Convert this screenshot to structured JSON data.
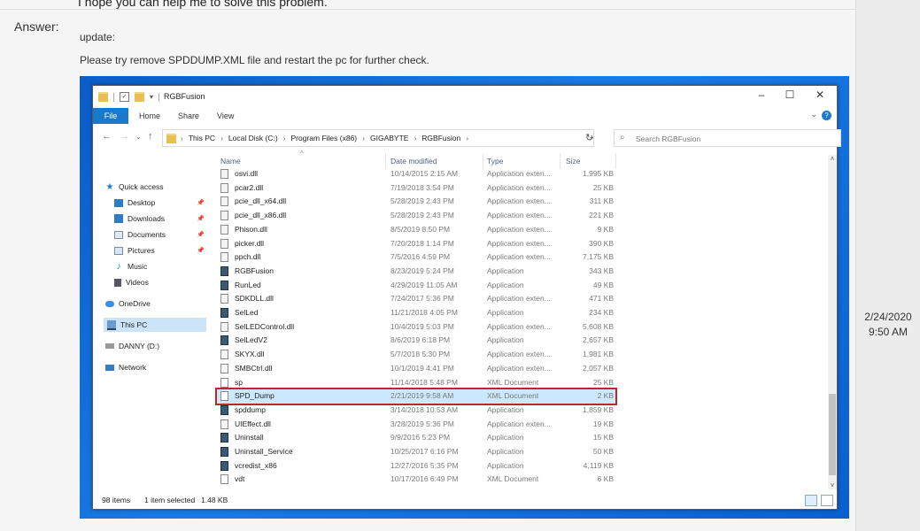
{
  "post": {
    "previous_text": "I hope you can help me to solve this problem.",
    "answer_label": "Answer:",
    "line1": "update:",
    "line2": "Please try  remove SPDDUMP.XML file and restart the pc for further check.",
    "timestamp_date": "2/24/2020",
    "timestamp_time": "9:50 AM"
  },
  "explorer": {
    "window_title": "RGBFusion",
    "tabs": [
      "File",
      "Home",
      "Share",
      "View"
    ],
    "breadcrumbs": [
      "This PC",
      "Local Disk (C:)",
      "Program Files (x86)",
      "GIGABYTE",
      "RGBFusion"
    ],
    "search_placeholder": "Search RGBFusion",
    "nav": [
      {
        "label": "Quick access",
        "icon": "star-icon"
      },
      {
        "label": "Desktop",
        "icon": "desktop-icon",
        "pinned": true
      },
      {
        "label": "Downloads",
        "icon": "downloads-icon",
        "pinned": true
      },
      {
        "label": "Documents",
        "icon": "documents-icon",
        "pinned": true
      },
      {
        "label": "Pictures",
        "icon": "pictures-icon",
        "pinned": true
      },
      {
        "label": "Music",
        "icon": "music-icon"
      },
      {
        "label": "Videos",
        "icon": "videos-icon"
      },
      {
        "label": "OneDrive",
        "icon": "onedrive-icon"
      },
      {
        "label": "This PC",
        "icon": "this-pc-icon",
        "selected": true
      },
      {
        "label": "DANNY (D:)",
        "icon": "usb-drive-icon"
      },
      {
        "label": "Network",
        "icon": "network-icon"
      }
    ],
    "columns": {
      "name": "Name",
      "date": "Date modified",
      "type": "Type",
      "size": "Size"
    },
    "files": [
      {
        "name": "osvi.dll",
        "date": "10/14/2015 2:15 AM",
        "type": "Application exten...",
        "size": "1,995 KB",
        "kind": "dll"
      },
      {
        "name": "pcar2.dll",
        "date": "7/19/2018 3:54 PM",
        "type": "Application exten...",
        "size": "25 KB",
        "kind": "dll"
      },
      {
        "name": "pcie_dll_x64.dll",
        "date": "5/28/2019 2:43 PM",
        "type": "Application exten...",
        "size": "311 KB",
        "kind": "dll"
      },
      {
        "name": "pcie_dll_x86.dll",
        "date": "5/28/2019 2:43 PM",
        "type": "Application exten...",
        "size": "221 KB",
        "kind": "dll"
      },
      {
        "name": "Phison.dll",
        "date": "8/5/2019 8:50 PM",
        "type": "Application exten...",
        "size": "9 KB",
        "kind": "dll"
      },
      {
        "name": "picker.dll",
        "date": "7/20/2018 1:14 PM",
        "type": "Application exten...",
        "size": "390 KB",
        "kind": "dll"
      },
      {
        "name": "ppch.dll",
        "date": "7/5/2016 4:59 PM",
        "type": "Application exten...",
        "size": "7,175 KB",
        "kind": "dll"
      },
      {
        "name": "RGBFusion",
        "date": "8/23/2019 5:24 PM",
        "type": "Application",
        "size": "343 KB",
        "kind": "app"
      },
      {
        "name": "RunLed",
        "date": "4/29/2019 11:05 AM",
        "type": "Application",
        "size": "49 KB",
        "kind": "app"
      },
      {
        "name": "SDKDLL.dll",
        "date": "7/24/2017 5:36 PM",
        "type": "Application exten...",
        "size": "471 KB",
        "kind": "dll"
      },
      {
        "name": "SelLed",
        "date": "11/21/2018 4:05 PM",
        "type": "Application",
        "size": "234 KB",
        "kind": "app"
      },
      {
        "name": "SelLEDControl.dll",
        "date": "10/4/2019 5:03 PM",
        "type": "Application exten...",
        "size": "5,608 KB",
        "kind": "dll"
      },
      {
        "name": "SelLedV2",
        "date": "8/6/2019 6:18 PM",
        "type": "Application",
        "size": "2,657 KB",
        "kind": "app"
      },
      {
        "name": "SKYX.dll",
        "date": "5/7/2018 5:30 PM",
        "type": "Application exten...",
        "size": "1,981 KB",
        "kind": "dll"
      },
      {
        "name": "SMBCtrl.dll",
        "date": "10/1/2019 4:41 PM",
        "type": "Application exten...",
        "size": "2,057 KB",
        "kind": "dll"
      },
      {
        "name": "sp",
        "date": "11/14/2018 5:48 PM",
        "type": "XML Document",
        "size": "25 KB",
        "kind": "xml"
      },
      {
        "name": "SPD_Dump",
        "date": "2/21/2019 9:58 AM",
        "type": "XML Document",
        "size": "2 KB",
        "kind": "xml",
        "highlighted": true
      },
      {
        "name": "spddump",
        "date": "3/14/2018 10:53 AM",
        "type": "Application",
        "size": "1,859 KB",
        "kind": "app"
      },
      {
        "name": "UIEffect.dll",
        "date": "3/28/2019 5:36 PM",
        "type": "Application exten...",
        "size": "19 KB",
        "kind": "dll"
      },
      {
        "name": "Uninstall",
        "date": "9/9/2016 5:23 PM",
        "type": "Application",
        "size": "15 KB",
        "kind": "app"
      },
      {
        "name": "Uninstall_Service",
        "date": "10/25/2017 6:16 PM",
        "type": "Application",
        "size": "50 KB",
        "kind": "app"
      },
      {
        "name": "vcredist_x86",
        "date": "12/27/2016 5:35 PM",
        "type": "Application",
        "size": "4,119 KB",
        "kind": "app"
      },
      {
        "name": "vdt",
        "date": "10/17/2016 6:49 PM",
        "type": "XML Document",
        "size": "6 KB",
        "kind": "xml"
      }
    ],
    "status": {
      "items": "98 items",
      "selected": "1 item selected",
      "size": "1.48 KB"
    },
    "colors": {
      "accent": "#1979ca",
      "highlight_border": "#c0252c",
      "selection": "#cce8ff"
    }
  }
}
